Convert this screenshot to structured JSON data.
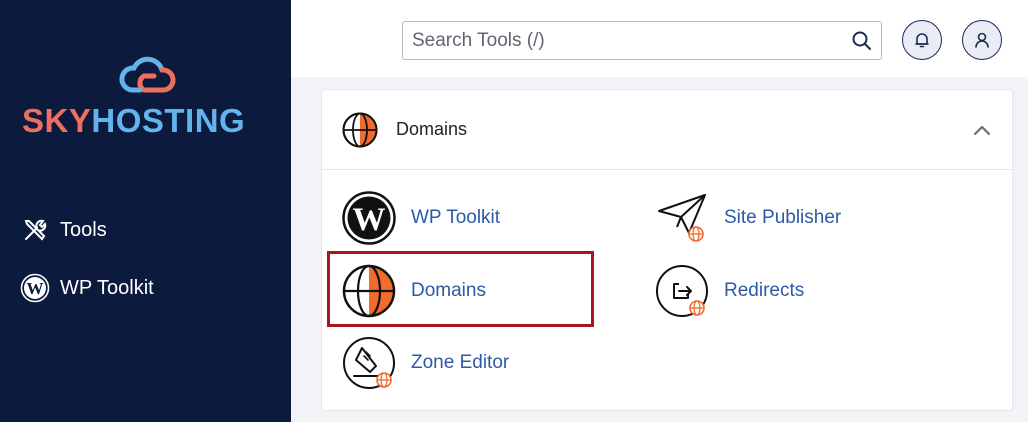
{
  "brand": {
    "part1": "SKY",
    "part2": "HOSTING"
  },
  "sidebar": {
    "items": [
      {
        "label": "Tools",
        "icon": "tools-icon"
      },
      {
        "label": "WP Toolkit",
        "icon": "wordpress-icon"
      }
    ]
  },
  "header": {
    "search_placeholder": "Search Tools (/)"
  },
  "section": {
    "title": "Domains",
    "expanded": true,
    "tools": [
      {
        "label": "WP Toolkit",
        "icon": "wordpress-icon"
      },
      {
        "label": "Site Publisher",
        "icon": "paper-plane-icon"
      },
      {
        "label": "Domains",
        "icon": "globe-icon"
      },
      {
        "label": "Redirects",
        "icon": "redirect-icon"
      },
      {
        "label": "Zone Editor",
        "icon": "zone-editor-icon"
      }
    ]
  },
  "colors": {
    "sidebar_bg": "#0c1b3d",
    "brand_coral": "#ef6f5e",
    "brand_blue": "#63b3ec",
    "link": "#2d5aa6",
    "highlight": "#a8141b",
    "accent_orange": "#f26b2a"
  }
}
